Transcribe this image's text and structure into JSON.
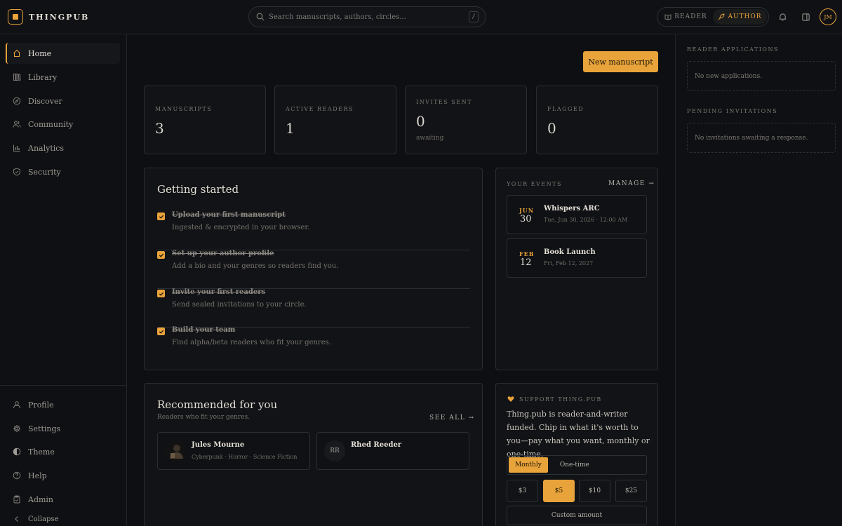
{
  "app": {
    "brand": "THINGPUB"
  },
  "search": {
    "placeholder": "Search manuscripts, authors, circles...",
    "shortcut": "/"
  },
  "mode": {
    "reader": "READER",
    "author": "AUTHOR"
  },
  "user": {
    "initials": "JM"
  },
  "sidebar": {
    "items": [
      {
        "label": "Home"
      },
      {
        "label": "Library"
      },
      {
        "label": "Discover"
      },
      {
        "label": "Community"
      },
      {
        "label": "Analytics"
      },
      {
        "label": "Security"
      }
    ],
    "bottom_items": [
      {
        "label": "Profile"
      },
      {
        "label": "Settings"
      },
      {
        "label": "Theme"
      },
      {
        "label": "Help"
      },
      {
        "label": "Admin"
      },
      {
        "label": "Collapse"
      }
    ]
  },
  "actions": {
    "new_manuscript": "New manuscript"
  },
  "stats": [
    {
      "label": "MANUSCRIPTS",
      "value": "3"
    },
    {
      "label": "ACTIVE READERS",
      "value": "1"
    },
    {
      "label": "INVITES SENT",
      "value": "0",
      "sub": "awaiting"
    },
    {
      "label": "FLAGGED",
      "value": "0"
    }
  ],
  "getting_started": {
    "title": "Getting started",
    "items": [
      {
        "title": "Upload your first manuscript",
        "sub": "Ingested & encrypted in your browser."
      },
      {
        "title": "Set up your author profile",
        "sub": "Add a bio and your genres so readers find you."
      },
      {
        "title": "Invite your first readers",
        "sub": "Send sealed invitations to your circle."
      },
      {
        "title": "Build your team",
        "sub": "Find alpha/beta readers who fit your genres."
      }
    ]
  },
  "events": {
    "label": "YOUR EVENTS",
    "manage": "MANAGE →",
    "items": [
      {
        "month": "JUN",
        "day": "30",
        "title": "Whispers ARC",
        "when": "Tue, Jun 30, 2026 · 12:00 AM"
      },
      {
        "month": "FEB",
        "day": "12",
        "title": "Book Launch",
        "when": "Fri, Feb 12, 2027"
      }
    ]
  },
  "recommended": {
    "title": "Recommended for you",
    "subtitle": "Readers who fit your genres.",
    "see_all": "SEE ALL →",
    "items": [
      {
        "name": "Jules Mourne",
        "genres": "Cyberpunk · Horror · Science Fiction",
        "initials": ""
      },
      {
        "name": "Rhed Reeder",
        "genres": "",
        "initials": "RR"
      }
    ]
  },
  "support": {
    "label": "SUPPORT THING.PUB",
    "text": "Thing.pub is reader-and-writer funded. Chip in what it's worth to you—pay what you want, monthly or one-time.",
    "monthly": "Monthly",
    "one_time": "One-time",
    "amounts": [
      "$3",
      "$5",
      "$10",
      "$25"
    ],
    "custom": "Custom amount"
  },
  "right_panel": {
    "applications_label": "READER APPLICATIONS",
    "applications_empty": "No new applications.",
    "invitations_label": "PENDING INVITATIONS",
    "invitations_empty": "No invitations awaiting a response."
  },
  "colors": {
    "accent": "#e8a33a",
    "background": "#0d0f12",
    "card": "#111316",
    "border": "#2a2e34"
  }
}
